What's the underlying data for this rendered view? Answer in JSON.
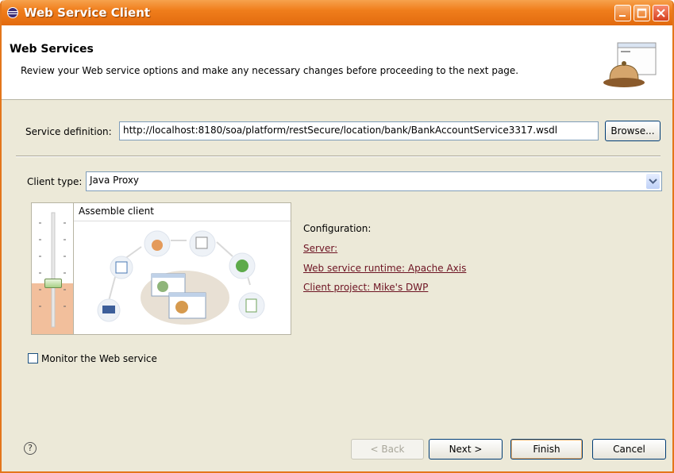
{
  "window": {
    "title": "Web Service Client"
  },
  "header": {
    "title": "Web Services",
    "description": "Review your Web service options and make any necessary changes before proceeding to the next page."
  },
  "service_definition": {
    "label": "Service definition:",
    "value": "http://localhost:8180/soa/platform/restSecure/location/bank/BankAccountService3317.wsdl",
    "browse_label": "Browse..."
  },
  "client_type": {
    "label": "Client type:",
    "value": "Java Proxy"
  },
  "panel": {
    "heading": "Assemble client",
    "slider_level_percent": 38
  },
  "configuration": {
    "label": "Configuration:",
    "server_link": "Server: ",
    "runtime_link": "Web service runtime: Apache Axis",
    "project_link": "Client project: Mike's DWP"
  },
  "monitor": {
    "label": "Monitor the Web service",
    "checked": false
  },
  "footer": {
    "help_icon": "?",
    "back_label": "< Back",
    "next_label": "Next >",
    "finish_label": "Finish",
    "cancel_label": "Cancel"
  },
  "colors": {
    "title_orange": "#e3761b",
    "link_color": "#6d1322",
    "dialog_bg": "#ece9d8"
  }
}
